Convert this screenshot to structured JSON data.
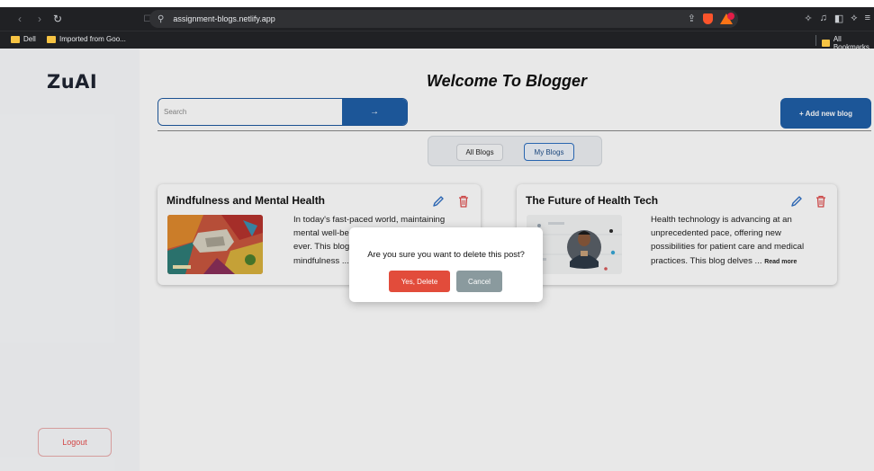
{
  "browser": {
    "url": "assignment-blogs.netlify.app",
    "nav": {
      "back_icon": "back-arrow-icon",
      "forward_icon": "forward-arrow-icon",
      "reload_icon": "reload-icon"
    },
    "bookmarks": [
      {
        "label": "Dell"
      },
      {
        "label": "Imported from Goo..."
      }
    ],
    "all_bookmarks": "All Bookmarks"
  },
  "sidebar": {
    "logo": "ZuAI",
    "logout_label": "Logout"
  },
  "main": {
    "heading": "Welcome To Blogger",
    "search": {
      "placeholder": "Search",
      "button_glyph": "→"
    },
    "add_button_label": "+ Add new blog",
    "tabs": [
      {
        "label": "All Blogs",
        "selected": false
      },
      {
        "label": "My Blogs",
        "selected": true
      }
    ]
  },
  "posts": [
    {
      "title": "Mindfulness and Mental Health",
      "excerpt_lines": [
        "In today's fast-paced world, maintaining",
        "mental well-be",
        "ever. This blog",
        "mindfulness ..."
      ],
      "read_more": ""
    },
    {
      "title": "The Future of Health Tech",
      "excerpt_lines": [
        "Health technology is advancing at an",
        "unprecedented pace, offering new",
        "possibilities for patient care and medical",
        "practices. This blog delves ..."
      ],
      "read_more": "Read more"
    }
  ],
  "modal": {
    "message": "Are you sure you want to delete this post?",
    "confirm_label": "Yes, Delete",
    "cancel_label": "Cancel"
  },
  "colors": {
    "primary": "#1f5fa8",
    "danger": "#e24c3b",
    "cancel": "#8a9a9e",
    "logout": "#e04c4c"
  }
}
